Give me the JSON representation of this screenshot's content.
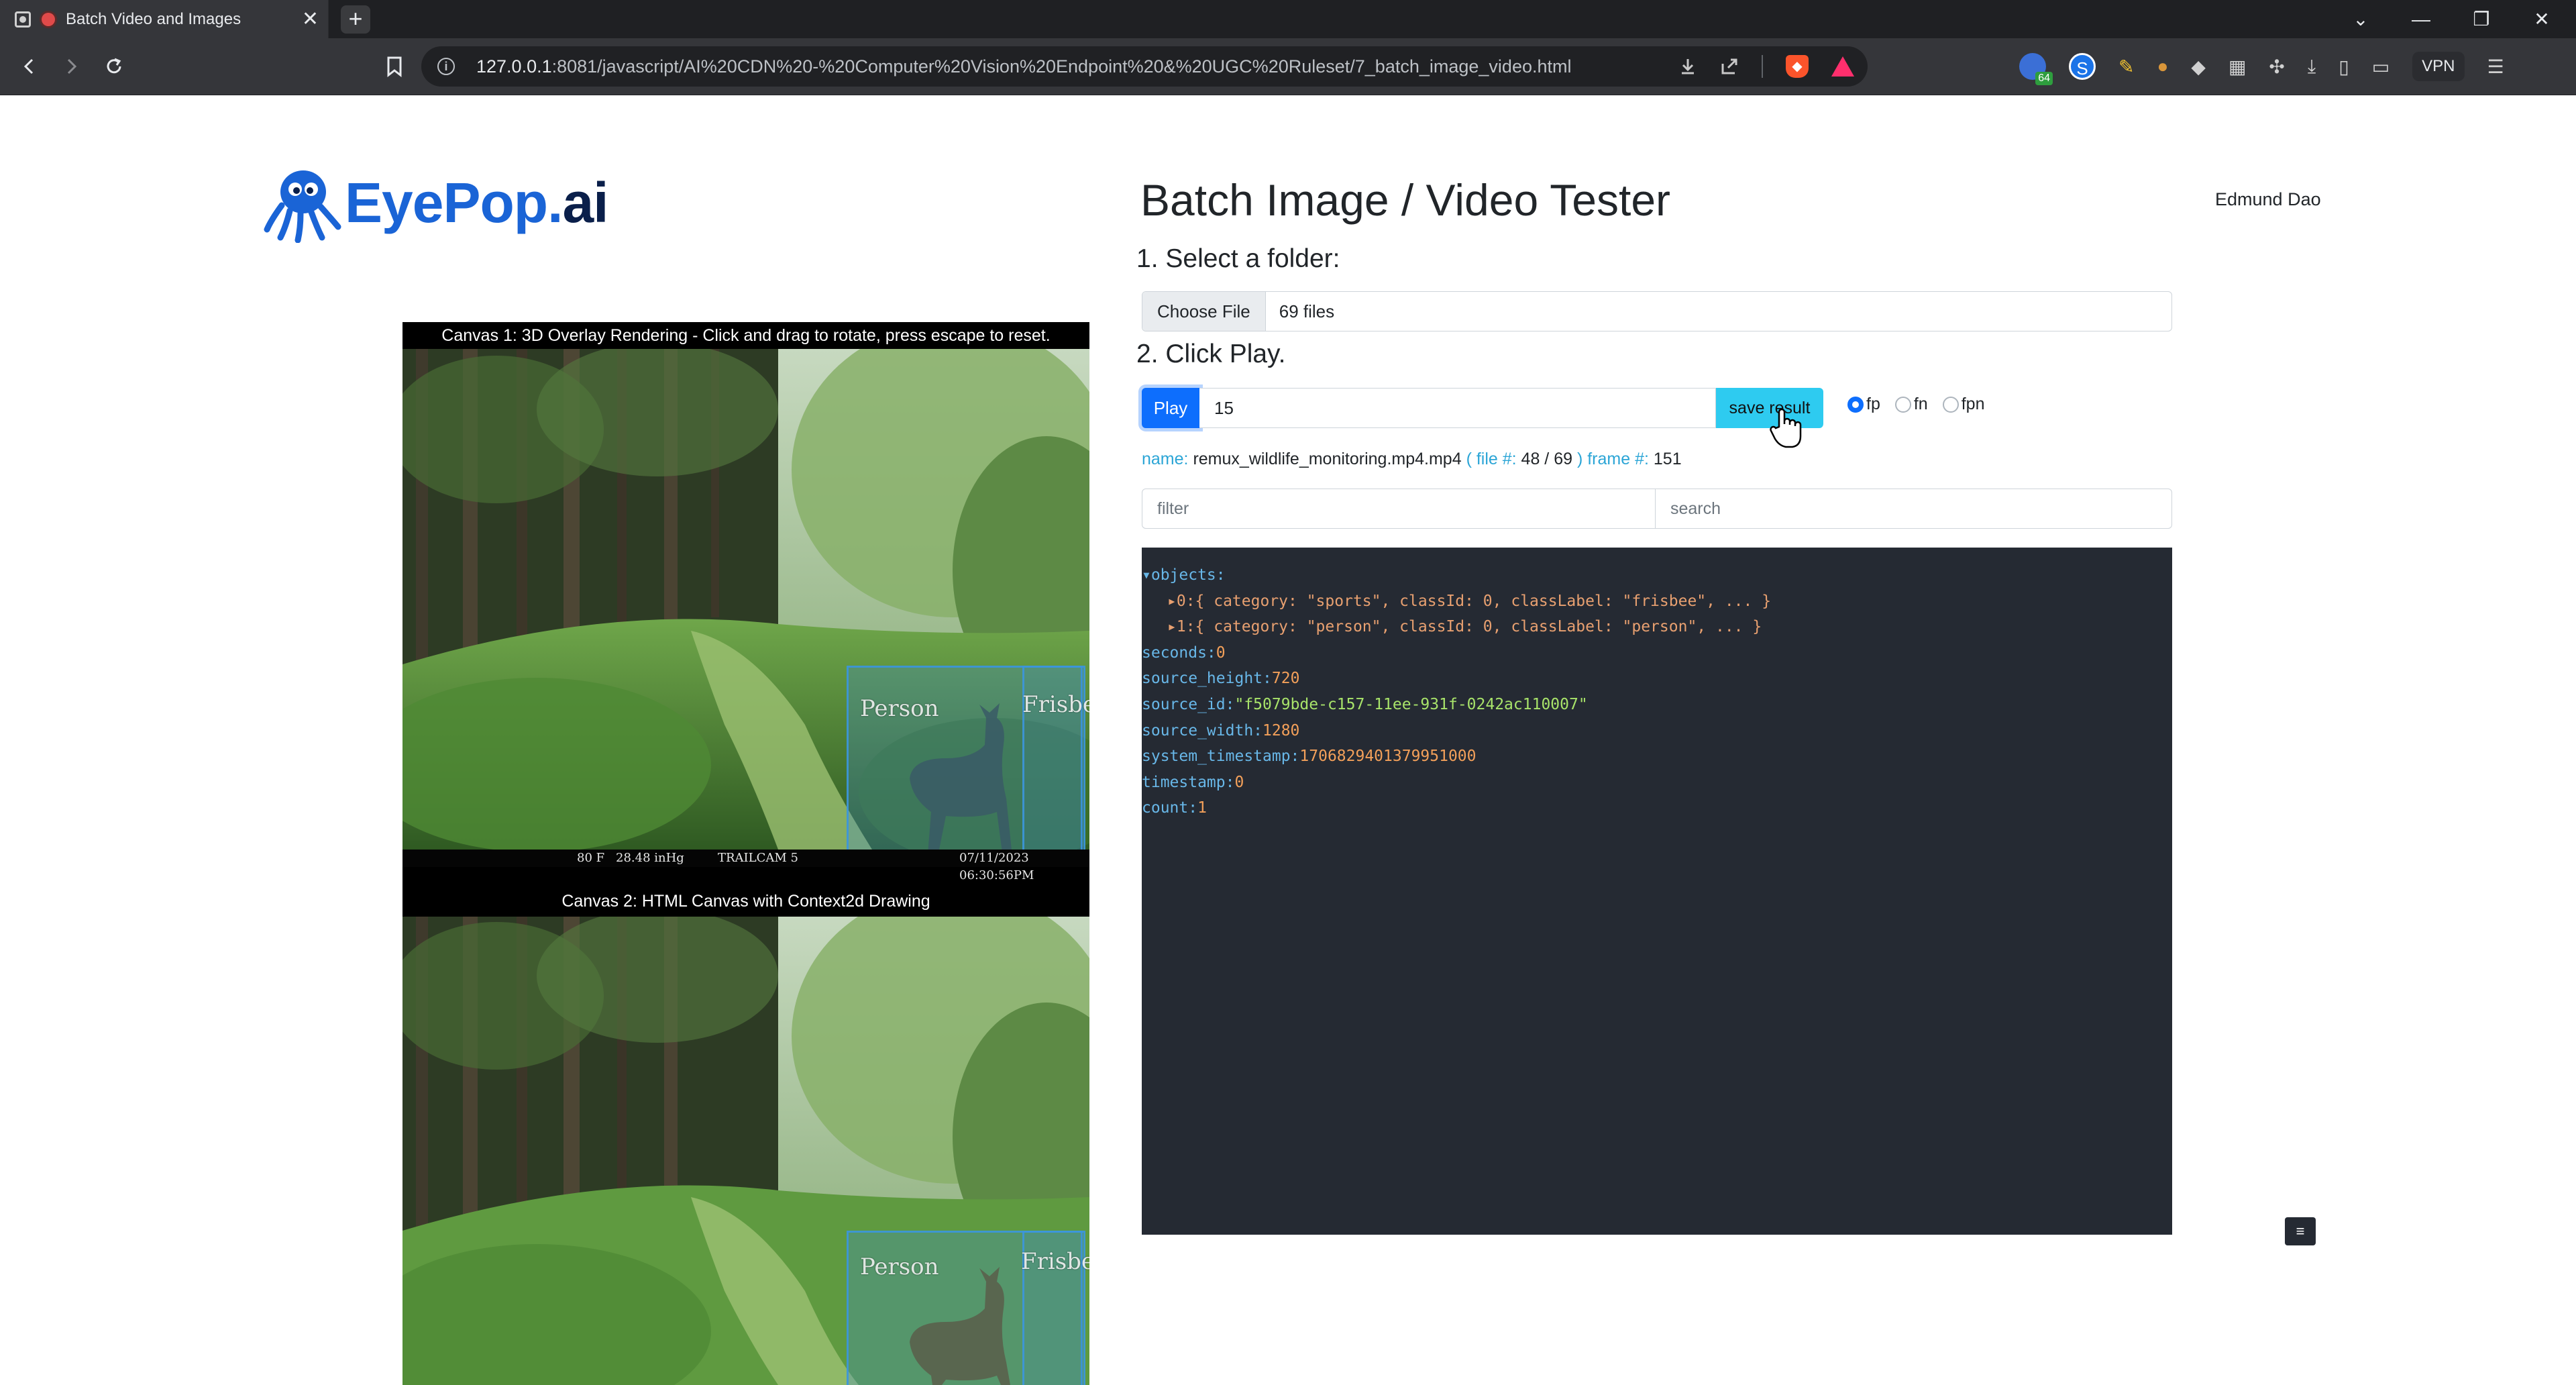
{
  "browser": {
    "tab_title": "Batch Video and Images",
    "tab_close": "✕",
    "new_tab": "+",
    "url_host": "127.0.0.1",
    "url_rest": ":8081/javascript/AI%20CDN%20-%20Computer%20Vision%20Endpoint%20&%20UGC%20Ruleset/7_batch_image_video.html",
    "ext_badge_count": "64",
    "vpn_label": "VPN",
    "window_controls": [
      "⌄",
      "—",
      "❐",
      "✕"
    ]
  },
  "header": {
    "logo_eye": "EyePop",
    "logo_dot": ".",
    "logo_ai": "ai",
    "title": "Batch Image / Video Tester",
    "user": "Edmund Dao"
  },
  "steps": {
    "step1": "1. Select a folder:",
    "step2": "2. Click Play."
  },
  "file_picker": {
    "button": "Choose File",
    "status": "69 files"
  },
  "controls": {
    "play": "Play",
    "frame_value": "15",
    "save": "save result",
    "radios": [
      {
        "label": "fp",
        "checked": true
      },
      {
        "label": "fn",
        "checked": false
      },
      {
        "label": "fpn",
        "checked": false
      }
    ]
  },
  "info": {
    "name_key": "name:",
    "name_val": "remux_wildlife_monitoring.mp4.mp4",
    "file_key_open": "( file #:",
    "file_val": "48 / 69",
    "file_key_close": ")",
    "frame_key": "frame #:",
    "frame_val": "151"
  },
  "filters": {
    "filter_placeholder": "filter",
    "search_placeholder": "search"
  },
  "json_view": {
    "objects_key": "▾objects:",
    "obj0": "▸0:{ category: \"sports\", classId: 0, classLabel: \"frisbee\", ... }",
    "obj1": "▸1:{ category: \"person\", classId: 0, classLabel: \"person\", ... }",
    "fields": [
      {
        "key": "seconds:",
        "value": "0",
        "type": "num"
      },
      {
        "key": "source_height:",
        "value": "720",
        "type": "num"
      },
      {
        "key": "source_id:",
        "value": "\"f5079bde-c157-11ee-931f-0242ac110007\"",
        "type": "str"
      },
      {
        "key": "source_width:",
        "value": "1280",
        "type": "num"
      },
      {
        "key": "system_timestamp:",
        "value": "1706829401379951000",
        "type": "num"
      },
      {
        "key": "timestamp:",
        "value": "0",
        "type": "num"
      },
      {
        "key": "count:",
        "value": "1",
        "type": "num"
      }
    ]
  },
  "canvas1": {
    "caption": "Canvas 1: 3D Overlay Rendering - Click and drag to rotate, press escape to reset.",
    "stamp_temp": "80 F",
    "stamp_pressure": "28.48 inHg",
    "stamp_cam": "TRAILCAM 5",
    "stamp_datetime": "07/11/2023 06:30:56PM",
    "label_person": "Person",
    "label_frisbee": "Frisbee"
  },
  "canvas2": {
    "caption": "Canvas 2: HTML Canvas with Context2d Drawing",
    "label_person": "Person",
    "label_frisbee": "Frisbee"
  },
  "misc": {
    "corner_button": "≡"
  }
}
